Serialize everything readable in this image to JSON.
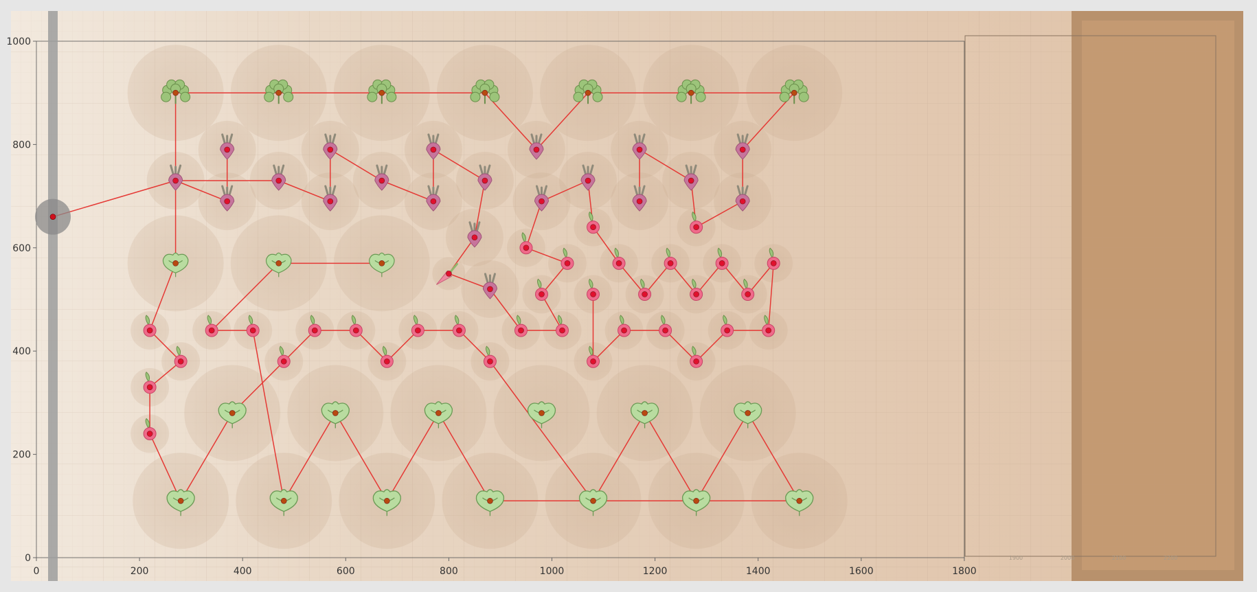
{
  "chart_data": {
    "type": "scatter",
    "title": "",
    "xlabel": "",
    "ylabel": "",
    "xlim": [
      0,
      1800
    ],
    "ylim": [
      0,
      1000
    ],
    "x_ticks": [
      "0",
      "200",
      "400",
      "600",
      "800",
      "1000",
      "1200",
      "1400",
      "1600",
      "1800"
    ],
    "y_ticks": [
      "0",
      "200",
      "400",
      "600",
      "800",
      "1000"
    ],
    "bed_ticks": [
      "1900",
      "2000",
      "2100",
      "2200"
    ],
    "grid": true,
    "legend": "none",
    "colors": {
      "path": "#e53935",
      "point": "#e0102e",
      "point_dark": "#b84a10",
      "spread": "#c8a98e",
      "bed": "#c49a72"
    },
    "start_point": [
      32,
      660
    ],
    "series": [
      {
        "type": "cilantro",
        "points": [
          [
            270,
            900
          ],
          [
            470,
            900
          ],
          [
            670,
            900
          ],
          [
            870,
            900
          ],
          [
            1070,
            900
          ],
          [
            1270,
            900
          ],
          [
            1470,
            900
          ]
        ]
      },
      {
        "type": "beet",
        "points": [
          [
            370,
            790
          ],
          [
            570,
            790
          ],
          [
            770,
            790
          ],
          [
            970,
            790
          ],
          [
            1170,
            790
          ],
          [
            1370,
            790
          ],
          [
            270,
            730
          ],
          [
            470,
            730
          ],
          [
            670,
            730
          ],
          [
            870,
            730
          ],
          [
            1070,
            730
          ],
          [
            1270,
            730
          ],
          [
            370,
            690
          ],
          [
            570,
            690
          ],
          [
            770,
            690
          ],
          [
            980,
            690
          ],
          [
            1170,
            690
          ],
          [
            1370,
            690
          ],
          [
            850,
            620
          ],
          [
            880,
            520
          ]
        ]
      },
      {
        "type": "lettuce_small",
        "points": [
          [
            270,
            570
          ],
          [
            470,
            570
          ],
          [
            670,
            570
          ]
        ]
      },
      {
        "type": "radish",
        "points": [
          [
            1080,
            640
          ],
          [
            1280,
            640
          ],
          [
            950,
            600
          ],
          [
            1030,
            570
          ],
          [
            1130,
            570
          ],
          [
            1230,
            570
          ],
          [
            1330,
            570
          ],
          [
            1430,
            570
          ],
          [
            980,
            510
          ],
          [
            1080,
            510
          ],
          [
            1180,
            510
          ],
          [
            1280,
            510
          ],
          [
            1380,
            510
          ],
          [
            220,
            440
          ],
          [
            340,
            440
          ],
          [
            420,
            440
          ],
          [
            540,
            440
          ],
          [
            620,
            440
          ],
          [
            740,
            440
          ],
          [
            820,
            440
          ],
          [
            940,
            440
          ],
          [
            1020,
            440
          ],
          [
            1140,
            440
          ],
          [
            1220,
            440
          ],
          [
            1340,
            440
          ],
          [
            1420,
            440
          ],
          [
            280,
            380
          ],
          [
            480,
            380
          ],
          [
            680,
            380
          ],
          [
            880,
            380
          ],
          [
            1080,
            380
          ],
          [
            1280,
            380
          ],
          [
            220,
            330
          ],
          [
            220,
            240
          ]
        ]
      },
      {
        "type": "carrot",
        "points": [
          [
            800,
            550
          ]
        ]
      },
      {
        "type": "lettuce_large",
        "points": [
          [
            380,
            280
          ],
          [
            580,
            280
          ],
          [
            780,
            280
          ],
          [
            980,
            280
          ],
          [
            1180,
            280
          ],
          [
            1380,
            280
          ],
          [
            280,
            110
          ],
          [
            480,
            110
          ],
          [
            680,
            110
          ],
          [
            880,
            110
          ],
          [
            1080,
            110
          ],
          [
            1280,
            110
          ],
          [
            1480,
            110
          ]
        ]
      }
    ],
    "path": [
      [
        32,
        660
      ],
      [
        270,
        730
      ],
      [
        370,
        690
      ],
      [
        370,
        790
      ],
      [
        370,
        690
      ],
      [
        270,
        730
      ],
      [
        270,
        900
      ],
      [
        470,
        900
      ],
      [
        670,
        900
      ],
      [
        870,
        900
      ],
      [
        970,
        790
      ],
      [
        1070,
        900
      ],
      [
        1270,
        900
      ],
      [
        1470,
        900
      ],
      [
        1370,
        790
      ],
      [
        1370,
        690
      ],
      [
        1280,
        640
      ],
      [
        1270,
        730
      ],
      [
        1170,
        790
      ],
      [
        1170,
        690
      ],
      [
        1170,
        790
      ],
      [
        1270,
        730
      ],
      [
        1280,
        640
      ],
      [
        1370,
        690
      ],
      [
        1370,
        790
      ],
      [
        1470,
        900
      ],
      [
        1270,
        900
      ],
      [
        1070,
        900
      ],
      [
        970,
        790
      ],
      [
        870,
        900
      ],
      [
        670,
        900
      ],
      [
        470,
        900
      ],
      [
        270,
        900
      ],
      [
        270,
        730
      ],
      [
        470,
        730
      ],
      [
        570,
        690
      ],
      [
        570,
        790
      ],
      [
        670,
        730
      ],
      [
        770,
        690
      ],
      [
        770,
        790
      ],
      [
        870,
        730
      ],
      [
        850,
        620
      ],
      [
        800,
        550
      ],
      [
        880,
        520
      ],
      [
        940,
        440
      ],
      [
        1020,
        440
      ],
      [
        980,
        510
      ],
      [
        1030,
        570
      ],
      [
        950,
        600
      ],
      [
        980,
        690
      ],
      [
        1070,
        730
      ],
      [
        1080,
        640
      ],
      [
        1130,
        570
      ],
      [
        1180,
        510
      ],
      [
        1230,
        570
      ],
      [
        1280,
        510
      ],
      [
        1330,
        570
      ],
      [
        1380,
        510
      ],
      [
        1430,
        570
      ],
      [
        1420,
        440
      ],
      [
        1340,
        440
      ],
      [
        1280,
        380
      ],
      [
        1220,
        440
      ],
      [
        1140,
        440
      ],
      [
        1080,
        380
      ],
      [
        1080,
        510
      ],
      [
        1080,
        380
      ],
      [
        1140,
        440
      ],
      [
        1220,
        440
      ],
      [
        1280,
        380
      ],
      [
        1340,
        440
      ],
      [
        1420,
        440
      ],
      [
        1430,
        570
      ],
      [
        1380,
        510
      ],
      [
        1330,
        570
      ],
      [
        1280,
        510
      ],
      [
        1230,
        570
      ],
      [
        1180,
        510
      ],
      [
        1130,
        570
      ],
      [
        1080,
        640
      ],
      [
        1070,
        730
      ],
      [
        980,
        690
      ],
      [
        950,
        600
      ],
      [
        1030,
        570
      ],
      [
        980,
        510
      ],
      [
        1020,
        440
      ],
      [
        940,
        440
      ],
      [
        880,
        520
      ],
      [
        800,
        550
      ],
      [
        850,
        620
      ],
      [
        870,
        730
      ],
      [
        770,
        790
      ],
      [
        770,
        690
      ],
      [
        670,
        730
      ],
      [
        570,
        790
      ],
      [
        570,
        690
      ],
      [
        470,
        730
      ],
      [
        270,
        730
      ],
      [
        270,
        570
      ],
      [
        220,
        440
      ],
      [
        280,
        380
      ],
      [
        220,
        330
      ],
      [
        220,
        240
      ],
      [
        280,
        110
      ],
      [
        380,
        280
      ],
      [
        540,
        440
      ],
      [
        620,
        440
      ],
      [
        680,
        380
      ],
      [
        740,
        440
      ],
      [
        820,
        440
      ],
      [
        880,
        380
      ],
      [
        1080,
        110
      ],
      [
        1180,
        280
      ],
      [
        1280,
        110
      ],
      [
        1380,
        280
      ],
      [
        1480,
        110
      ],
      [
        1280,
        110
      ],
      [
        1080,
        110
      ],
      [
        880,
        110
      ],
      [
        780,
        280
      ],
      [
        680,
        110
      ],
      [
        580,
        280
      ],
      [
        480,
        110
      ],
      [
        420,
        440
      ],
      [
        340,
        440
      ],
      [
        470,
        570
      ],
      [
        670,
        570
      ]
    ]
  }
}
